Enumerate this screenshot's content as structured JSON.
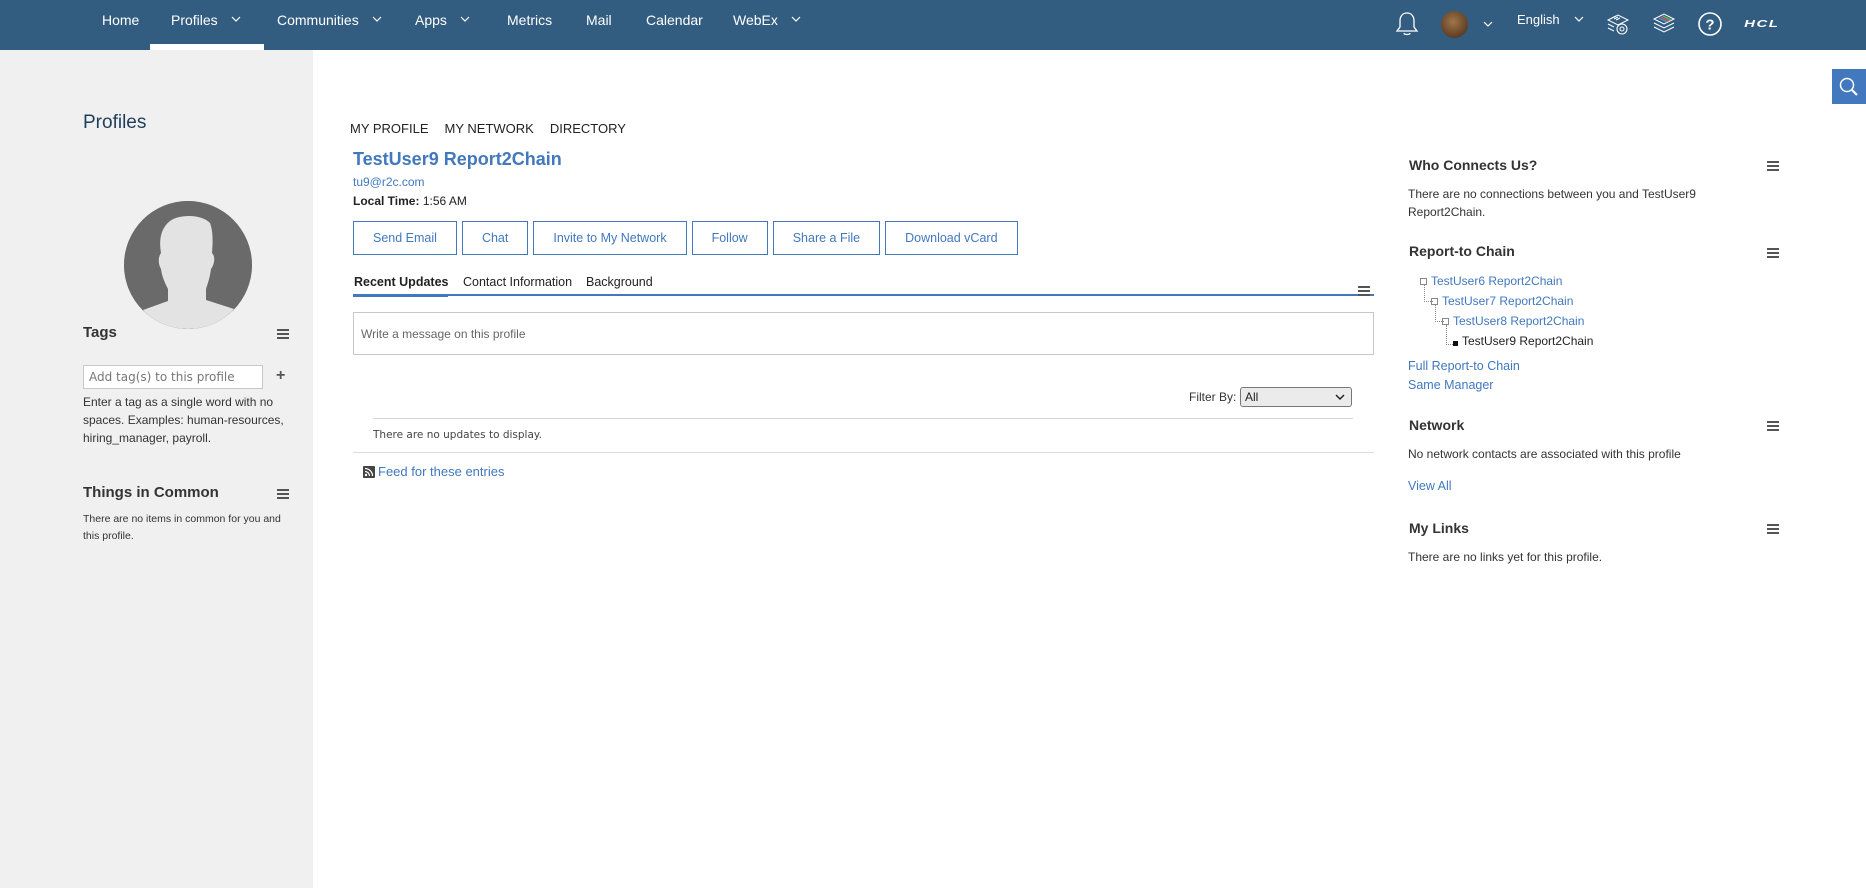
{
  "topnav": {
    "items": [
      {
        "label": "Home",
        "dropdown": false,
        "active": false
      },
      {
        "label": "Profiles",
        "dropdown": true,
        "active": true
      },
      {
        "label": "Communities",
        "dropdown": true,
        "active": false
      },
      {
        "label": "Apps",
        "dropdown": true,
        "active": false
      },
      {
        "label": "Metrics",
        "dropdown": false,
        "active": false
      },
      {
        "label": "Mail",
        "dropdown": false,
        "active": false
      },
      {
        "label": "Calendar",
        "dropdown": false,
        "active": false
      },
      {
        "label": "WebEx",
        "dropdown": true,
        "active": false
      }
    ],
    "language": "English",
    "brand": "HCL",
    "icons": [
      "bell-icon",
      "user-avatar",
      "settings-icon",
      "layers-icon",
      "help-icon",
      "hcl-logo"
    ]
  },
  "sidebar": {
    "title": "Profiles",
    "tags": {
      "heading": "Tags",
      "input_placeholder": "Add tag(s) to this profile",
      "add_label": "+",
      "help": "Enter a tag as a single word with no spaces. Examples: human-resources, hiring_manager, payroll."
    },
    "common": {
      "heading": "Things in Common",
      "text": "There are no items in common for you and this profile."
    }
  },
  "main": {
    "subnav": [
      "MY PROFILE",
      "MY NETWORK",
      "DIRECTORY"
    ],
    "profile": {
      "name": "TestUser9 Report2Chain",
      "email": "tu9@r2c.com",
      "local_time_label": "Local Time:",
      "local_time": "1:56 AM"
    },
    "actions": [
      "Send Email",
      "Chat",
      "Invite to My Network",
      "Follow",
      "Share a File",
      "Download vCard"
    ],
    "tabs": [
      {
        "label": "Recent Updates",
        "active": true
      },
      {
        "label": "Contact Information",
        "active": false
      },
      {
        "label": "Background",
        "active": false
      }
    ],
    "message_placeholder": "Write a message on this profile",
    "filter": {
      "label": "Filter By:",
      "value": "All"
    },
    "no_updates": "There are no updates to display.",
    "feed_link": "Feed for these entries"
  },
  "right": {
    "who_connects": {
      "heading": "Who Connects Us?",
      "text": "There are no connections between you and TestUser9 Report2Chain."
    },
    "report_chain": {
      "heading": "Report-to Chain",
      "chain": [
        {
          "name": "TestUser6 Report2Chain",
          "link": true
        },
        {
          "name": "TestUser7 Report2Chain",
          "link": true
        },
        {
          "name": "TestUser8 Report2Chain",
          "link": true
        },
        {
          "name": "TestUser9 Report2Chain",
          "link": false
        }
      ],
      "full_link": "Full Report-to Chain",
      "same_manager": "Same Manager"
    },
    "network": {
      "heading": "Network",
      "text": "No network contacts are associated with this profile",
      "view_all": "View All"
    },
    "links": {
      "heading": "My Links",
      "text": "There are no links yet for this profile."
    }
  },
  "colors": {
    "nav_bg": "#325c80",
    "accent": "#4178be",
    "sidebar_bg": "#f0f0f0"
  }
}
